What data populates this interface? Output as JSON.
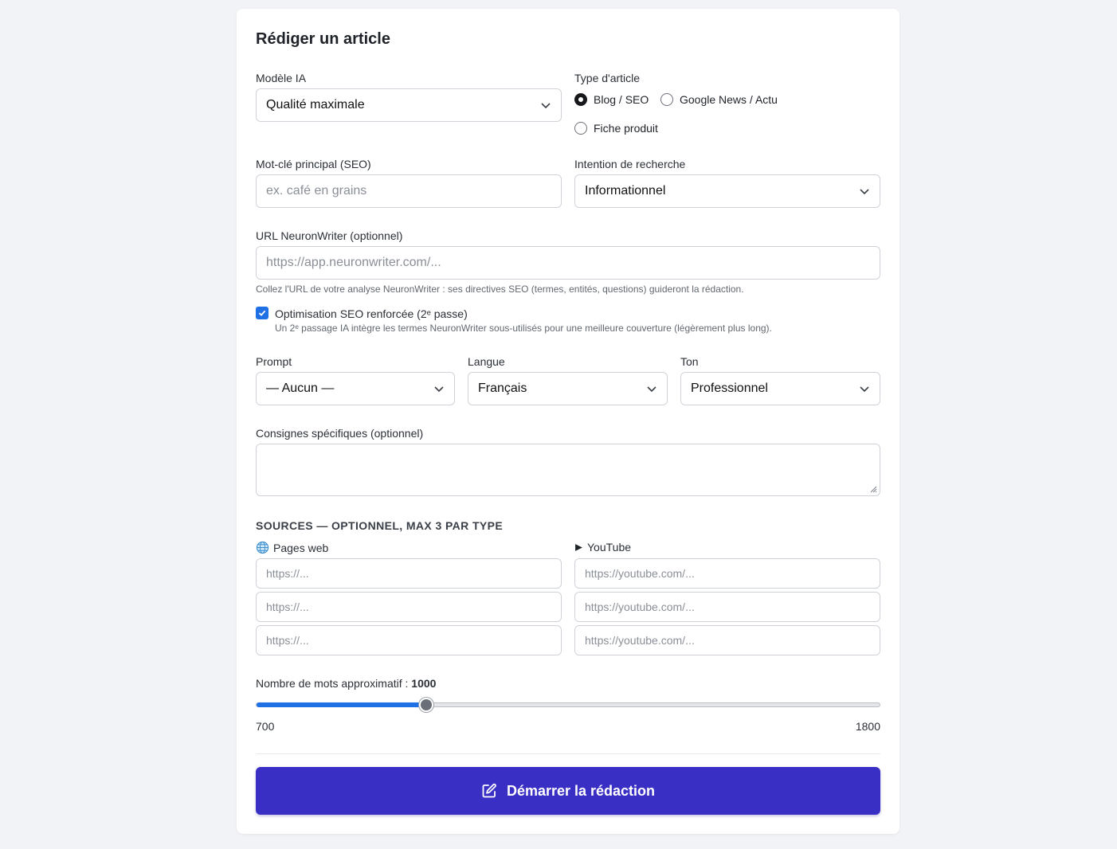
{
  "form": {
    "title": "Rédiger un article",
    "model": {
      "label": "Modèle IA",
      "value": "Qualité maximale"
    },
    "article_type": {
      "label": "Type d'article",
      "options": [
        "Blog / SEO",
        "Google News / Actu",
        "Fiche produit"
      ],
      "selected": "Blog / SEO"
    },
    "keyword": {
      "label": "Mot-clé principal (SEO)",
      "placeholder": "ex. café en grains"
    },
    "intent": {
      "label": "Intention de recherche",
      "value": "Informationnel"
    },
    "neuronwriter": {
      "label": "URL NeuronWriter (optionnel)",
      "placeholder": "https://app.neuronwriter.com/...",
      "help": "Collez l'URL de votre analyse NeuronWriter : ses directives SEO (termes, entités, questions) guideront la rédaction."
    },
    "seo_boost": {
      "checked": true,
      "label": "Optimisation SEO renforcée (2ᵉ passe)",
      "help": "Un 2ᵉ passage IA intègre les termes NeuronWriter sous-utilisés pour une meilleure couverture (légèrement plus long)."
    },
    "prompt": {
      "label": "Prompt",
      "value": "— Aucun —"
    },
    "language": {
      "label": "Langue",
      "value": "Français"
    },
    "tone": {
      "label": "Ton",
      "value": "Professionnel"
    },
    "instructions": {
      "label": "Consignes spécifiques (optionnel)"
    },
    "sources": {
      "heading": "SOURCES — OPTIONNEL, MAX 3 PAR TYPE",
      "web_label": "Pages web",
      "web_placeholders": [
        "https://...",
        "https://...",
        "https://..."
      ],
      "youtube_label": "YouTube",
      "youtube_placeholders": [
        "https://youtube.com/...",
        "https://youtube.com/...",
        "https://youtube.com/..."
      ]
    },
    "word_count": {
      "label": "Nombre de mots approximatif :",
      "value": "1000",
      "min": "700",
      "max": "1800"
    },
    "submit_label": "Démarrer la rédaction"
  },
  "colors": {
    "accent": "#1f6fe5",
    "button": "#3a2fc5"
  }
}
